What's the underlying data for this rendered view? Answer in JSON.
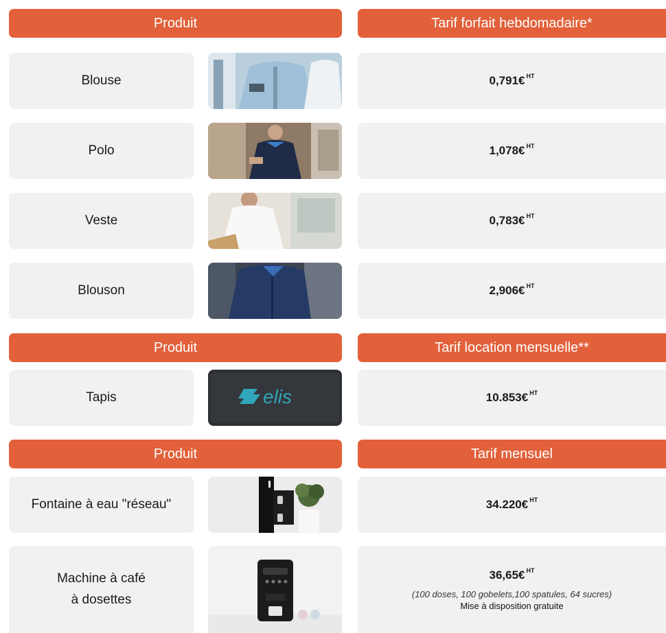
{
  "sections": [
    {
      "header_left": "Produit",
      "header_right": "Tarif forfait hebdomadaire*"
    },
    {
      "header_left": "Produit",
      "header_right": "Tarif location mensuelle**"
    },
    {
      "header_left": "Produit",
      "header_right": "Tarif mensuel"
    }
  ],
  "rows": [
    {
      "name": "Blouse",
      "price": "0,791€",
      "unit": "HT",
      "image": "lab-coat-photo"
    },
    {
      "name": "Polo",
      "price": "1,078€",
      "unit": "HT",
      "image": "polo-worker-photo"
    },
    {
      "name": "Veste",
      "price": "0,783€",
      "unit": "HT",
      "image": "white-jacket-photo"
    },
    {
      "name": "Blouson",
      "price": "2,906€",
      "unit": "HT",
      "image": "blue-jacket-photo"
    },
    {
      "name": "Tapis",
      "price": "10.853€",
      "unit": "HT",
      "image": "elis-mat-photo",
      "logo_text": "elis"
    },
    {
      "name": "Fontaine à eau \"réseau\"",
      "price": "34.220€",
      "unit": "HT",
      "image": "water-fountain-photo"
    },
    {
      "name_line1": "Machine à café",
      "name_line2": "à dosettes",
      "price": "36,65€",
      "unit": "HT",
      "image": "coffee-machine-photo",
      "note": "(100 doses, 100 gobelets,100 spatules, 64 sucres)",
      "note2": "Mise à disposition gratuite"
    }
  ],
  "colors": {
    "header": "#e2603a",
    "cell": "#f1f1f1",
    "text": "#1a1a1a"
  }
}
